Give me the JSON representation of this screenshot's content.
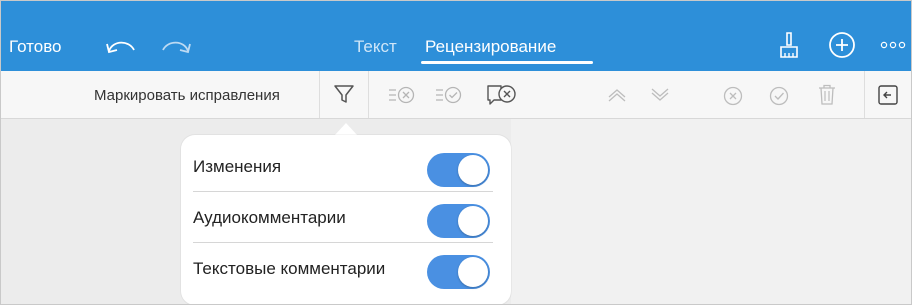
{
  "header": {
    "done_label": "Готово",
    "tabs": [
      {
        "label": "Текст",
        "active": false
      },
      {
        "label": "Рецензирование",
        "active": true
      }
    ]
  },
  "toolbar": {
    "track_changes_label": "Маркировать исправления"
  },
  "filter_popover": {
    "items": [
      {
        "label": "Изменения",
        "enabled": true
      },
      {
        "label": "Аудиокомментарии",
        "enabled": true
      },
      {
        "label": "Текстовые комментарии",
        "enabled": true
      }
    ]
  },
  "colors": {
    "accent": "#2d8fd9",
    "toggle_on": "#4a90e2",
    "toolbar_bg": "#f7f7f7",
    "page_bg": "#ececec"
  },
  "icons": {
    "undo": "undo-icon",
    "redo": "redo-icon",
    "format": "paintbrush-icon",
    "add": "plus-circle-icon",
    "more": "more-icon",
    "filter": "filter-icon",
    "reject_all": "reject-all-icon",
    "accept_all": "accept-all-icon",
    "delete_comment": "delete-comment-icon",
    "prev": "chevron-up-icon",
    "next": "chevron-down-icon",
    "reject": "reject-icon",
    "accept": "accept-icon",
    "trash": "trash-icon",
    "sidebar": "sidebar-icon"
  }
}
